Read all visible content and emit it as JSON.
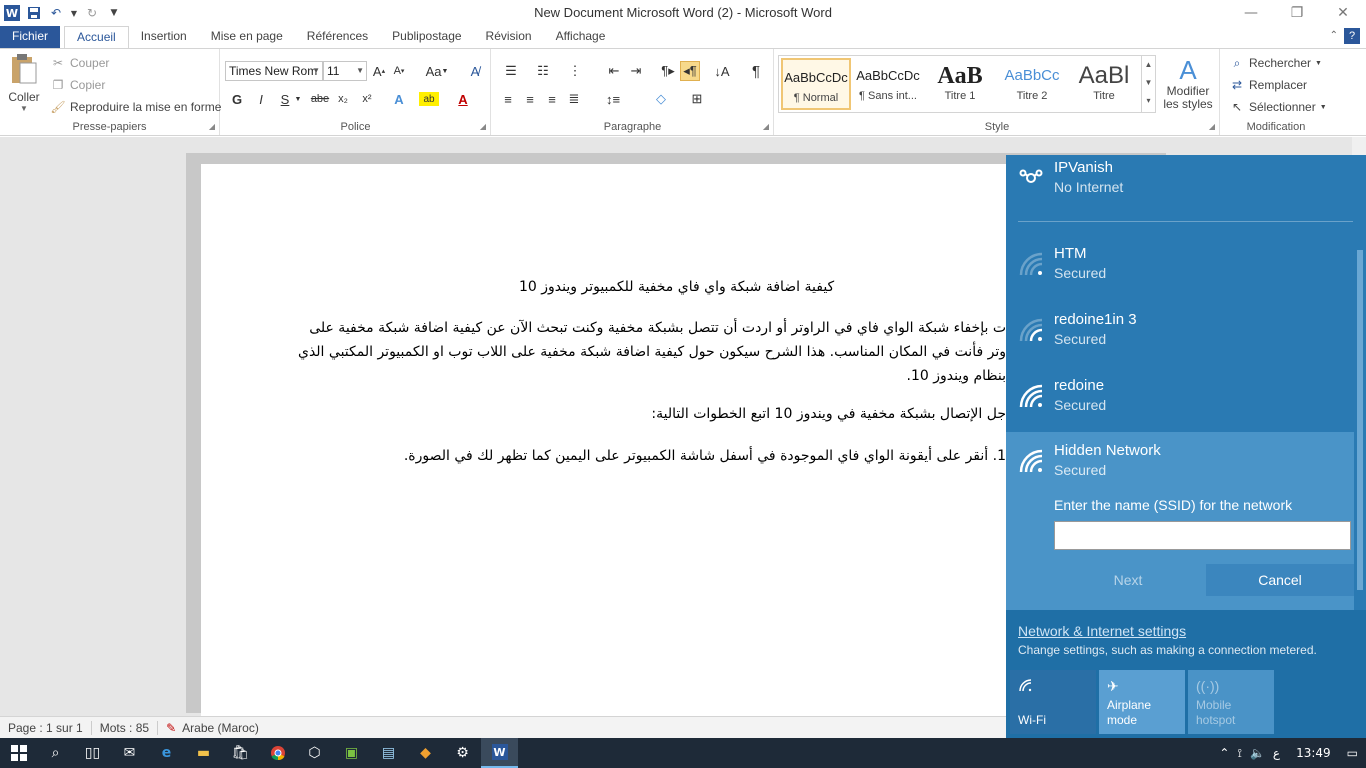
{
  "window": {
    "title": "New Document Microsoft Word (2)  -  Microsoft Word",
    "minimize": "—",
    "restore": "❐",
    "close": "✕"
  },
  "qat": {
    "logo": "W",
    "save_icon": "save-icon",
    "undo_icon": "undo-icon",
    "redo_icon": "redo-icon"
  },
  "tabs": [
    "Fichier",
    "Accueil",
    "Insertion",
    "Mise en page",
    "Références",
    "Publipostage",
    "Révision",
    "Affichage"
  ],
  "ribbon": {
    "clipboard": {
      "paste": "Coller",
      "cut": "Couper",
      "copy": "Copier",
      "format_painter": "Reproduire la mise en forme",
      "label": "Presse-papiers"
    },
    "font": {
      "font_name": "Times New Rom",
      "font_size": "11",
      "bold": "G",
      "italic": "I",
      "underline": "S",
      "strike": "abe",
      "subscript": "x₂",
      "superscript": "x²",
      "label": "Police"
    },
    "paragraph": {
      "label": "Paragraphe",
      "show_marks": "¶"
    },
    "styles": {
      "items": [
        {
          "sample": "AaBbCcDc",
          "name": "¶ Normal"
        },
        {
          "sample": "AaBbCcDc",
          "name": "¶ Sans int..."
        },
        {
          "sample": "AaB",
          "name": "Titre 1"
        },
        {
          "sample": "AaBbCc",
          "name": "Titre 2"
        },
        {
          "sample": "AaBl",
          "name": "Titre"
        }
      ],
      "modify": "Modifier les styles",
      "label": "Style"
    },
    "editing": {
      "find": "Rechercher",
      "replace": "Remplacer",
      "select": "Sélectionner",
      "label": "Modification"
    }
  },
  "document": {
    "title": "كيفية اضافة شبكة واي فاي مخفية للكمبيوتر ويندوز 10",
    "p1_l1": "ت بإخفاء شبكة الواي فاي في الراوتر أو اردت أن تتصل بشبكة مخفية وكنت تبحث  الآن عن كيفية اضافة شبكة مخفية على",
    "p1_l2": "وتر فأنت في المكان المناسب. هذا الشرح سيكون حول كيفية اضافة شبكة مخفية على اللاب توب او الكمبيوتر المكتبي الذي",
    "p1_l3": "بنظام ويندوز 10.",
    "p2": "جل الإتصال بشبكة مخفية في ويندوز 10 اتبع الخطوات التالية:",
    "p3": "1.   أنقر على أيقونة الواي فاي الموجودة في أسفل شاشة الكمبيوتر على اليمين كما تظهر لك في الصورة."
  },
  "status": {
    "page": "Page : 1 sur 1",
    "words": "Mots : 85",
    "language": "Arabe (Maroc)"
  },
  "wifi_panel": {
    "networks": [
      {
        "name": "IPVanish",
        "status": "No Internet",
        "icon": "vpn-icon"
      },
      {
        "name": "HTM",
        "status": "Secured",
        "icon": "wifi-weak-icon"
      },
      {
        "name": "redoine1in 3",
        "status": "Secured",
        "icon": "wifi-weak-icon"
      },
      {
        "name": "redoine",
        "status": "Secured",
        "icon": "wifi-icon"
      },
      {
        "name": "Hidden Network",
        "status": "Secured",
        "icon": "wifi-icon"
      }
    ],
    "ssid_label": "Enter the name (SSID) for the network",
    "ssid_value": "",
    "next": "Next",
    "cancel": "Cancel",
    "settings_link": "Network & Internet settings",
    "settings_desc": "Change settings, such as making a connection metered.",
    "quick_actions": [
      {
        "label": "Wi-Fi",
        "state": "on"
      },
      {
        "label": "Airplane mode",
        "state": "off"
      },
      {
        "label": "Mobile hotspot",
        "state": "disabled"
      }
    ]
  },
  "taskbar": {
    "time": "13:49",
    "lang": "ع"
  },
  "colors": {
    "word_blue": "#2b579a",
    "panel_blue": "#1f6fa6",
    "taskbar": "#1e2a38"
  }
}
